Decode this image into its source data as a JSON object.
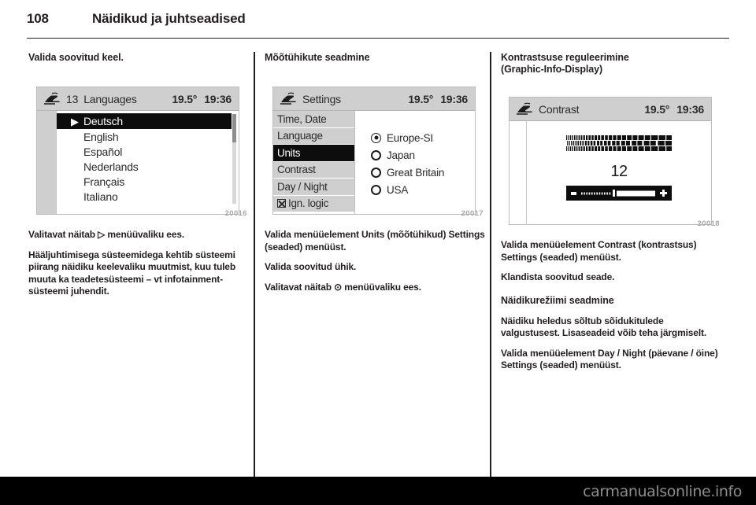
{
  "header": {
    "page_number": "108",
    "title": "Näidikud ja juhtseadised"
  },
  "columns": {
    "left": {
      "heading": "Valida soovitud keel.",
      "figure": {
        "number": "20016",
        "display": {
          "icon": "vehicle-icon",
          "index": "13",
          "title": "Languages",
          "temperature": "19.5°",
          "clock": "19:36",
          "caret": "▶",
          "items": [
            {
              "label": "Deutsch",
              "selected": true
            },
            {
              "label": "English",
              "selected": false
            },
            {
              "label": "Español",
              "selected": false
            },
            {
              "label": "Nederlands",
              "selected": false
            },
            {
              "label": "Français",
              "selected": false
            },
            {
              "label": "Italiano",
              "selected": false
            }
          ]
        }
      },
      "paragraphs": [
        "Valitavat näitab ▷ menüüvaliku ees.",
        "Hääljuhtimisega süsteemidega kehtib süsteemi piirang näidiku keelevaliku muutmist, kuu tuleb muuta ka teadetesüsteemi – vt infotainment-süsteemi juhendit."
      ]
    },
    "middle": {
      "heading": "Mõõtühikute seadmine",
      "figure": {
        "number": "20017",
        "display": {
          "icon": "vehicle-icon",
          "title": "Settings",
          "temperature": "19.5°",
          "clock": "19:36",
          "menu": [
            {
              "label": "Time, Date",
              "selected": false,
              "checkbox": false
            },
            {
              "label": "Language",
              "selected": false,
              "checkbox": false
            },
            {
              "label": "Units",
              "selected": true,
              "checkbox": false
            },
            {
              "label": "Contrast",
              "selected": false,
              "checkbox": false
            },
            {
              "label": "Day / Night",
              "selected": false,
              "checkbox": false
            },
            {
              "label": "Ign. logic",
              "selected": false,
              "checkbox": true
            }
          ],
          "options": [
            {
              "label": "Europe-SI",
              "selected": true
            },
            {
              "label": "Japan",
              "selected": false
            },
            {
              "label": "Great Britain",
              "selected": false
            },
            {
              "label": "USA",
              "selected": false
            }
          ]
        }
      },
      "paragraphs": [
        "Valida menüüelement Units (mõõtühikud) Settings (seaded) menüüst.",
        "Valida soovitud ühik.",
        "Valitavat näitab ⊙ menüüvaliku ees."
      ]
    },
    "right": {
      "heading_line1": "Kontrastsuse reguleerimine",
      "heading_line2": "(Graphic-Info-Display)",
      "figure": {
        "number": "20018",
        "display": {
          "icon": "vehicle-icon",
          "title": "Contrast",
          "temperature": "19.5°",
          "clock": "19:36",
          "value": "12",
          "slider_minus": "−",
          "slider_plus": "+"
        }
      },
      "paragraphs": [
        "Valida menüüelement Contrast (kontrastsus) Settings (seaded) menüüst.",
        "Klandista soovitud seade."
      ],
      "subheading": "Näidikurežiimi seadmine",
      "paragraphs2": [
        "Näidiku heledus sõltub sõidukitulede valgustusest. Lisaseadeid võib teha järgmiselt.",
        "Valida menüüelement Day / Night (päevane / öine) Settings (seaded) menüüst."
      ]
    }
  },
  "watermark": "carmanualsonline.info"
}
